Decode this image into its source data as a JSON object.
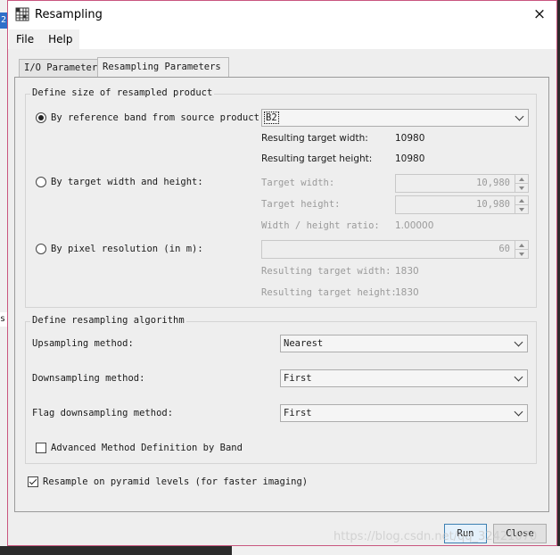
{
  "background": {
    "marker_top": "2",
    "marker_mid": "s"
  },
  "window": {
    "title": "Resampling",
    "close_label": "×"
  },
  "menu": {
    "items": [
      "File",
      "Help"
    ]
  },
  "tabs": [
    {
      "label": "I/O Parameters",
      "active": false
    },
    {
      "label": "Resampling Parameters",
      "active": true
    }
  ],
  "size_group": {
    "title": "Define size of resampled product",
    "by_reference": {
      "label": "By reference band from source product:",
      "selected": true,
      "band_value": "B2",
      "result_width_label": "Resulting target width:",
      "result_width_value": "10980",
      "result_height_label": "Resulting target height:",
      "result_height_value": "10980"
    },
    "by_target": {
      "label": "By target width and height:",
      "selected": false,
      "width_label": "Target width:",
      "width_value": "10,980",
      "height_label": "Target height:",
      "height_value": "10,980",
      "ratio_label": "Width / height ratio:",
      "ratio_value": "1.00000"
    },
    "by_resolution": {
      "label": "By pixel resolution (in m):",
      "selected": false,
      "resolution_value": "60",
      "result_width_label": "Resulting target width:",
      "result_width_value": "1830",
      "result_height_label": "Resulting target height:",
      "result_height_value": "1830"
    }
  },
  "algorithm_group": {
    "title": "Define resampling algorithm",
    "upsampling_label": "Upsampling method:",
    "upsampling_value": "Nearest",
    "downsampling_label": "Downsampling method:",
    "downsampling_value": "First",
    "flag_downsampling_label": "Flag downsampling method:",
    "flag_downsampling_value": "First",
    "advanced_label": "Advanced Method Definition by Band",
    "advanced_checked": false
  },
  "pyramid": {
    "label": "Resample on pyramid levels (for faster imaging)",
    "checked": true
  },
  "buttons": {
    "run": "Run",
    "close": "Close"
  },
  "watermark": "https://blog.csdn.net/qq_32421070",
  "colors": {
    "window_border": "#c9567f",
    "default_button_border": "#3c7fb1",
    "panel_bg": "#eeeeee"
  }
}
